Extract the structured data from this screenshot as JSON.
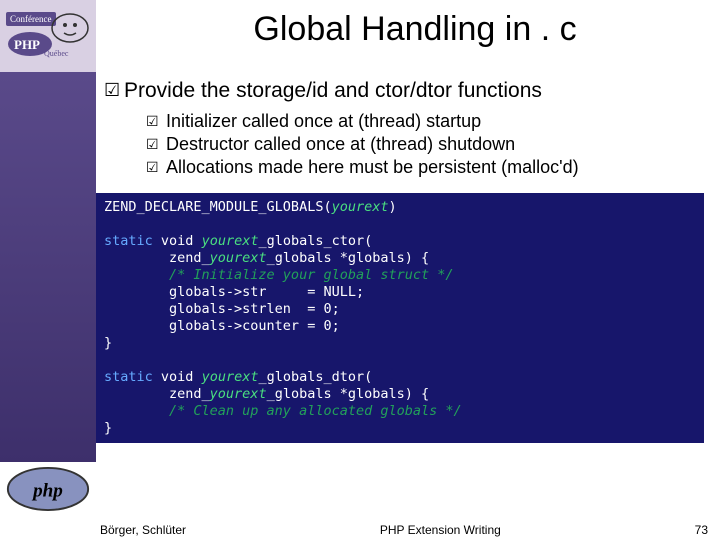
{
  "title": "Global Handling in . c",
  "lead": "Provide the storage/id and ctor/dtor functions",
  "bullets": [
    "Initializer called once at (thread) startup",
    "Destructor called once at (thread) shutdown",
    "Allocations made here must be persistent (malloc'd)"
  ],
  "code": {
    "l1a": "ZEND_DECLARE_MODULE_GLOBALS(",
    "l1b": "yourext",
    "l1c": ")",
    "blank": " ",
    "l2a": "static",
    "l2b": " void ",
    "l2c": "yourext",
    "l2d": "_globals_ctor(",
    "l3a": "        zend_",
    "l3b": "yourext",
    "l3c": "_globals *globals) {",
    "l4": "        /* Initialize your global struct */",
    "l5": "        globals->str     = NULL;",
    "l6": "        globals->strlen  = 0;",
    "l7": "        globals->counter = 0;",
    "l8": "}",
    "l9a": "static",
    "l9b": " void ",
    "l9c": "yourext",
    "l9d": "_globals_dtor(",
    "l10a": "        zend_",
    "l10b": "yourext",
    "l10c": "_globals *globals) {",
    "l11": "        /* Clean up any allocated globals */",
    "l12": "}"
  },
  "footer": {
    "authors": "Börger, Schlüter",
    "title": "PHP Extension Writing",
    "page": "73"
  }
}
